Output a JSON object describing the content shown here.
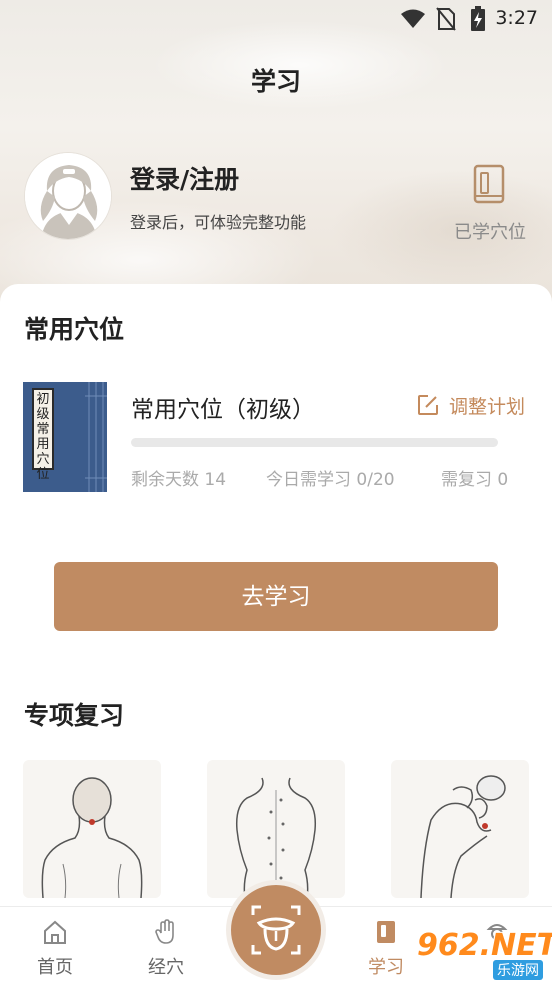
{
  "status_bar": {
    "time": "3:27"
  },
  "header": {
    "title": "学习",
    "login_title": "登录/注册",
    "login_subtitle": "登录后，可体验完整功能",
    "learned_label": "已学穴位"
  },
  "common_points": {
    "section_title": "常用穴位",
    "book_cover_text": "初级常用穴位",
    "plan_title": "常用穴位（初级）",
    "adjust_label": "调整计划",
    "progress": 0,
    "stats": {
      "remaining_days": "剩余天数 14",
      "today_study": "今日需学习 0/20",
      "need_review": "需复习  0"
    },
    "go_button": "去学习"
  },
  "special_review": {
    "section_title": "专项复习",
    "cards": [
      "neck-acupoint-card",
      "back-acupoint-card",
      "foot-acupoint-card"
    ]
  },
  "tabbar": {
    "items": [
      {
        "label": "首页",
        "icon": "home-icon"
      },
      {
        "label": "经穴",
        "icon": "palm-icon"
      },
      {
        "label": "学习",
        "icon": "book-icon",
        "active": true
      },
      {
        "label": "",
        "icon": "mine-icon"
      }
    ],
    "center_icon": "tongue-scan-icon"
  },
  "watermark": {
    "text": "962.NET",
    "sub": "乐游网"
  },
  "colors": {
    "accent": "#c08b62",
    "adjust": "#c48a5c",
    "book": "#3c5c8c"
  }
}
